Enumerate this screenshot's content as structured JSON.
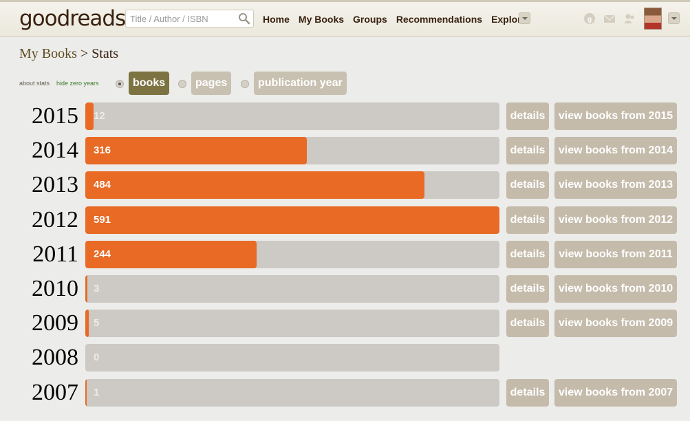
{
  "header": {
    "logo": "goodreads",
    "search_placeholder": "Title / Author / ISBN",
    "nav": [
      "Home",
      "My Books",
      "Groups",
      "Recommendations",
      "Explore"
    ]
  },
  "title": {
    "crumb": "My Books",
    "separator": " > ",
    "page": "Stats"
  },
  "controls": {
    "about_stats": "about stats",
    "hide_zero": "hide zero years",
    "toggles": [
      "books",
      "pages",
      "publication year"
    ],
    "selected": "books"
  },
  "buttons": {
    "details": "details",
    "view_prefix": "view books from "
  },
  "colors": {
    "bar": "#e86a24",
    "track": "#cdc9c4",
    "active_toggle": "#7c7242"
  },
  "chart_data": {
    "type": "bar",
    "categories": [
      "2015",
      "2014",
      "2013",
      "2012",
      "2011",
      "2010",
      "2009",
      "2008",
      "2007"
    ],
    "values": [
      12,
      316,
      484,
      591,
      244,
      3,
      5,
      0,
      1
    ],
    "max": 591
  }
}
